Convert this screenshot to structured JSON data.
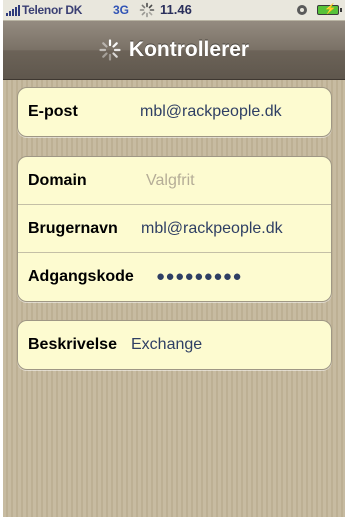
{
  "status_bar": {
    "carrier": "Telenor DK",
    "network": "3G",
    "time": "11.46",
    "icons": [
      "signal-icon",
      "activity-icon",
      "lock-rotation-icon",
      "battery-charging-icon"
    ]
  },
  "nav": {
    "title": "Kontrollerer",
    "icon": "spinner-icon"
  },
  "groups": {
    "email": {
      "label": "E-post",
      "value": "mbl@rackpeople.dk"
    },
    "server": {
      "domain_label": "Domain",
      "domain_placeholder": "Valgfrit",
      "username_label": "Brugernavn",
      "username_value": "mbl@rackpeople.dk",
      "password_label": "Adgangskode",
      "password_value": "●●●●●●●●●"
    },
    "description": {
      "label": "Beskrivelse",
      "value": "Exchange"
    }
  },
  "colors": {
    "nav_bar": "#7a7166",
    "cell_background": "#fdfbd0",
    "value_text": "#2f3f64",
    "placeholder_text": "#b5ad97",
    "network_text": "#3154b5",
    "battery": "#56c23a"
  }
}
